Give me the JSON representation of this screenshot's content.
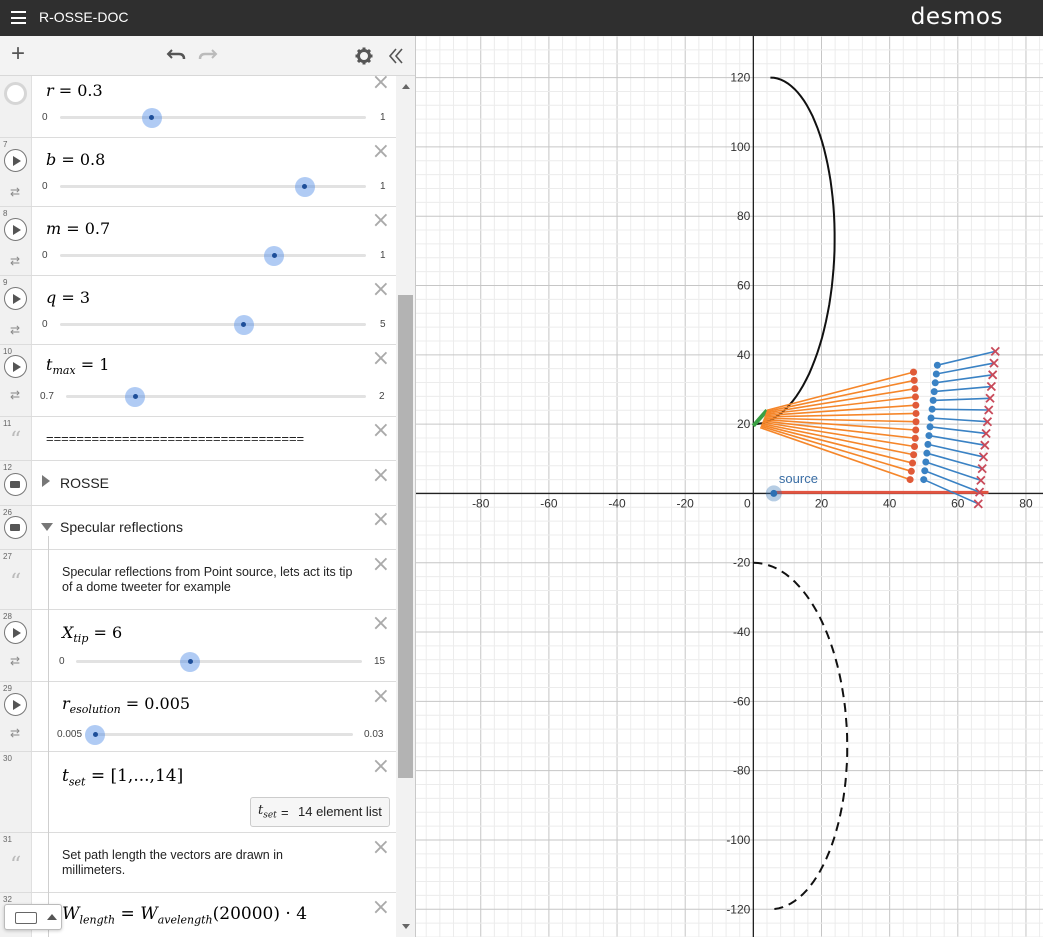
{
  "header": {
    "title": "R-OSSE-DOC",
    "logo": "desmos",
    "menu_icon": "hamburger-icon"
  },
  "toolbar": {
    "add_icon": "plus-icon",
    "undo_icon": "undo-icon",
    "redo_icon": "redo-icon",
    "settings_icon": "gear-icon",
    "collapse_icon": "double-chevron-left-icon"
  },
  "expressions": [
    {
      "num": "",
      "lhs": "r",
      "rhs": "0.3",
      "min": "0",
      "max": "1",
      "value": 0.3,
      "lo": 0,
      "hi": 1
    },
    {
      "num": "7",
      "lhs": "b",
      "rhs": "0.8",
      "min": "0",
      "max": "1",
      "value": 0.8,
      "lo": 0,
      "hi": 1
    },
    {
      "num": "8",
      "lhs": "m",
      "rhs": "0.7",
      "min": "0",
      "max": "1",
      "value": 0.7,
      "lo": 0,
      "hi": 1
    },
    {
      "num": "9",
      "lhs": "q",
      "rhs": "3",
      "min": "0",
      "max": "5",
      "value": 3,
      "lo": 0,
      "hi": 5
    },
    {
      "num": "10",
      "lhs": "t",
      "lhs_sub": "max",
      "rhs": "1",
      "min": "0.7",
      "max": "2",
      "value": 1,
      "lo": 0.7,
      "hi": 2
    },
    {
      "num": "11",
      "note": "=================================="
    },
    {
      "num": "12",
      "folder": "ROSSE"
    },
    {
      "num": "26",
      "folder": "Specular reflections"
    },
    {
      "num": "27",
      "note": "Specular reflections from Point source, lets act its tip of a dome tweeter for example"
    },
    {
      "num": "28",
      "lhs": "X",
      "lhs_sub": "tip",
      "rhs": "6",
      "min": "0",
      "max": "15",
      "value": 6,
      "lo": 0,
      "hi": 15
    },
    {
      "num": "29",
      "lhs": "r",
      "lhs_sub": "esolution",
      "rhs": "0.005",
      "min": "0.005",
      "max": "0.03",
      "value": 0.005,
      "lo": 0.005,
      "hi": 0.03
    },
    {
      "num": "30",
      "lhs": "t",
      "lhs_sub": "set",
      "rhs": "[1,...,14]",
      "badge_lhs": "t",
      "badge_sub": "set",
      "badge_eq": "=",
      "badge_val": "14 element list"
    },
    {
      "num": "31",
      "note": "Set path length the vectors are drawn in millimeters."
    },
    {
      "num": "32",
      "lhs": "W",
      "lhs_sub": "length",
      "rhs_var": "W",
      "rhs_sub": "avelength",
      "rhs_arg": "(20000)",
      "rhs_tail": "· 4"
    }
  ],
  "graph": {
    "x_ticks": [
      "-80",
      "-60",
      "-40",
      "-20",
      "0",
      "20",
      "40",
      "60",
      "80"
    ],
    "y_ticks": [
      "120",
      "100",
      "80",
      "60",
      "40",
      "20",
      "-20",
      "-40",
      "-60",
      "-80",
      "-100",
      "-120"
    ],
    "xlim": [
      -99,
      85
    ],
    "ylim": [
      -128,
      132
    ],
    "source_label": "source",
    "colors": {
      "curve": "#111111",
      "orange": "#f5862a",
      "red": "#e05a38",
      "blue": "#3a82c4",
      "cross": "#c84a5a",
      "green": "#3aa043",
      "source_line": "#e25542",
      "source_point": "#2d70b3",
      "label": "#3a6ea5"
    }
  },
  "keyboard": {
    "icon": "keyboard-icon",
    "toggle_icon": "caret-up-icon"
  }
}
